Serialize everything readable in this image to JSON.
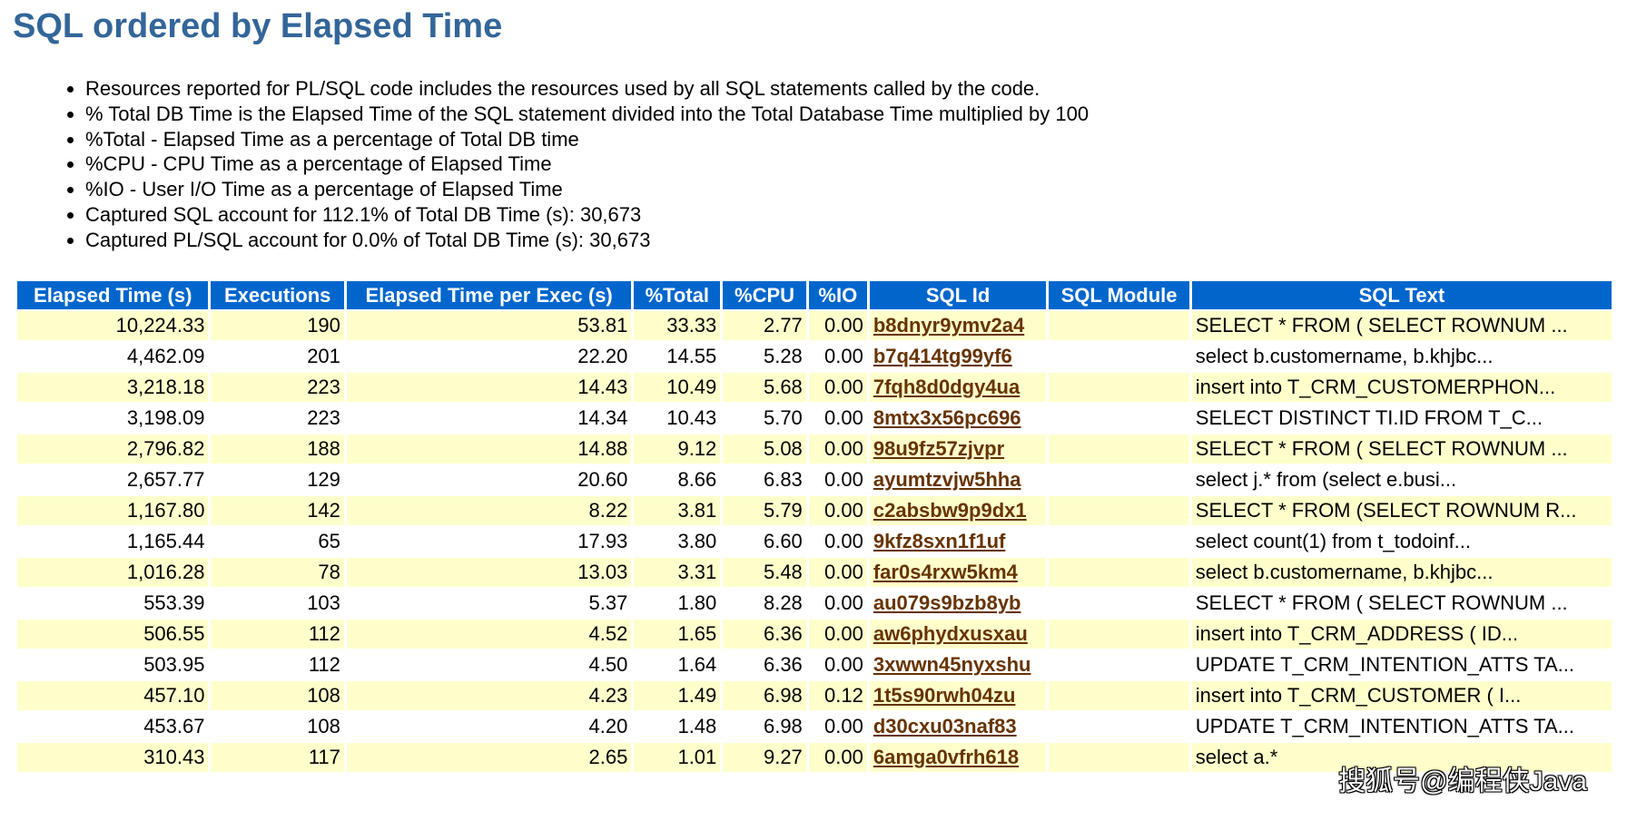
{
  "page": {
    "title": "SQL ordered by Elapsed Time",
    "notes": [
      "Resources reported for PL/SQL code includes the resources used by all SQL statements called by the code.",
      "% Total DB Time is the Elapsed Time of the SQL statement divided into the Total Database Time multiplied by 100",
      "%Total - Elapsed Time as a percentage of Total DB time",
      "%CPU - CPU Time as a percentage of Elapsed Time",
      "%IO - User I/O Time as a percentage of Elapsed Time",
      "Captured SQL account for 112.1% of Total DB Time (s): 30,673",
      "Captured PL/SQL account for 0.0% of Total DB Time (s): 30,673"
    ]
  },
  "table": {
    "columns": [
      "Elapsed Time (s)",
      "Executions",
      "Elapsed Time per Exec (s)",
      "%Total",
      "%CPU",
      "%IO",
      "SQL Id",
      "SQL Module",
      "SQL Text"
    ],
    "rows": [
      {
        "elapsed": "10,224.33",
        "executions": "190",
        "per_exec": "53.81",
        "total": "33.33",
        "cpu": "2.77",
        "io": "0.00",
        "sql_id": "b8dnyr9ymv2a4",
        "module": "",
        "text": "SELECT * FROM ( SELECT ROWNUM ..."
      },
      {
        "elapsed": "4,462.09",
        "executions": "201",
        "per_exec": "22.20",
        "total": "14.55",
        "cpu": "5.28",
        "io": "0.00",
        "sql_id": "b7q414tg99yf6",
        "module": "",
        "text": "select b.customername, b.khjbc..."
      },
      {
        "elapsed": "3,218.18",
        "executions": "223",
        "per_exec": "14.43",
        "total": "10.49",
        "cpu": "5.68",
        "io": "0.00",
        "sql_id": "7fqh8d0dgy4ua",
        "module": "",
        "text": "insert into T_CRM_CUSTOMERPHON..."
      },
      {
        "elapsed": "3,198.09",
        "executions": "223",
        "per_exec": "14.34",
        "total": "10.43",
        "cpu": "5.70",
        "io": "0.00",
        "sql_id": "8mtx3x56pc696",
        "module": "",
        "text": "SELECT DISTINCT TI.ID FROM T_C..."
      },
      {
        "elapsed": "2,796.82",
        "executions": "188",
        "per_exec": "14.88",
        "total": "9.12",
        "cpu": "5.08",
        "io": "0.00",
        "sql_id": "98u9fz57zjvpr",
        "module": "",
        "text": "SELECT * FROM ( SELECT ROWNUM ..."
      },
      {
        "elapsed": "2,657.77",
        "executions": "129",
        "per_exec": "20.60",
        "total": "8.66",
        "cpu": "6.83",
        "io": "0.00",
        "sql_id": "ayumtzvjw5hha",
        "module": "",
        "text": "select j.* from (select e.busi..."
      },
      {
        "elapsed": "1,167.80",
        "executions": "142",
        "per_exec": "8.22",
        "total": "3.81",
        "cpu": "5.79",
        "io": "0.00",
        "sql_id": "c2absbw9p9dx1",
        "module": "",
        "text": "SELECT * FROM (SELECT ROWNUM R..."
      },
      {
        "elapsed": "1,165.44",
        "executions": "65",
        "per_exec": "17.93",
        "total": "3.80",
        "cpu": "6.60",
        "io": "0.00",
        "sql_id": "9kfz8sxn1f1uf",
        "module": "",
        "text": "select count(1) from t_todoinf..."
      },
      {
        "elapsed": "1,016.28",
        "executions": "78",
        "per_exec": "13.03",
        "total": "3.31",
        "cpu": "5.48",
        "io": "0.00",
        "sql_id": "far0s4rxw5km4",
        "module": "",
        "text": "select b.customername, b.khjbc..."
      },
      {
        "elapsed": "553.39",
        "executions": "103",
        "per_exec": "5.37",
        "total": "1.80",
        "cpu": "8.28",
        "io": "0.00",
        "sql_id": "au079s9bzb8yb",
        "module": "",
        "text": "SELECT * FROM ( SELECT ROWNUM ..."
      },
      {
        "elapsed": "506.55",
        "executions": "112",
        "per_exec": "4.52",
        "total": "1.65",
        "cpu": "6.36",
        "io": "0.00",
        "sql_id": "aw6phydxusxau",
        "module": "",
        "text": "insert into T_CRM_ADDRESS ( ID..."
      },
      {
        "elapsed": "503.95",
        "executions": "112",
        "per_exec": "4.50",
        "total": "1.64",
        "cpu": "6.36",
        "io": "0.00",
        "sql_id": "3xwwn45nyxshu",
        "module": "",
        "text": "UPDATE T_CRM_INTENTION_ATTS TA..."
      },
      {
        "elapsed": "457.10",
        "executions": "108",
        "per_exec": "4.23",
        "total": "1.49",
        "cpu": "6.98",
        "io": "0.12",
        "sql_id": "1t5s90rwh04zu",
        "module": "",
        "text": "insert into T_CRM_CUSTOMER ( I..."
      },
      {
        "elapsed": "453.67",
        "executions": "108",
        "per_exec": "4.20",
        "total": "1.48",
        "cpu": "6.98",
        "io": "0.00",
        "sql_id": "d30cxu03naf83",
        "module": "",
        "text": "UPDATE T_CRM_INTENTION_ATTS TA..."
      },
      {
        "elapsed": "310.43",
        "executions": "117",
        "per_exec": "2.65",
        "total": "1.01",
        "cpu": "9.27",
        "io": "0.00",
        "sql_id": "6amga0vfrh618",
        "module": "",
        "text": "select a.* "
      }
    ]
  },
  "watermark": "搜狐号@编程侠Java",
  "colors": {
    "title": "#336699",
    "header_bg": "#0066CC",
    "header_text": "#FFFFFF",
    "row_alt_bg": "#FFFFCC",
    "link": "#663300"
  }
}
